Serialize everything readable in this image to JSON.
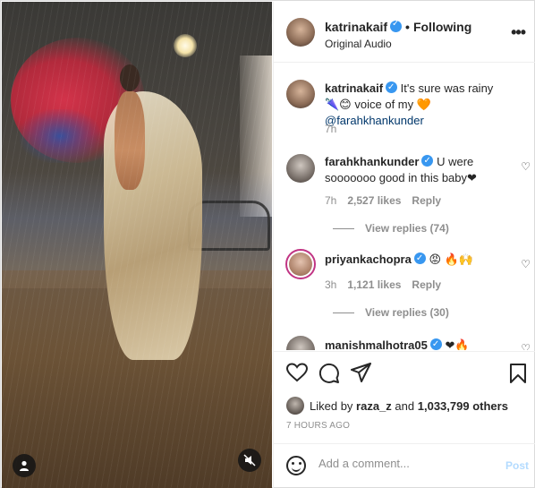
{
  "header": {
    "username": "katrinakaif",
    "separator": "•",
    "follow_status": "Following",
    "audio": "Original Audio",
    "more": "•••"
  },
  "caption": {
    "username": "katrinakaif",
    "text_part1": "It's sure was rainy 🌂😊",
    "text_part2": "voice of my 🧡",
    "mention": "@farahkhankunder",
    "time": "7h"
  },
  "comments": [
    {
      "username": "farahkhankunder",
      "text": "U were sooooooo good in this baby❤",
      "time": "7h",
      "likes": "2,527 likes",
      "reply": "Reply",
      "view_replies": "View replies (74)"
    },
    {
      "username": "priyankachopra",
      "text": "😡 🔥🙌",
      "time": "3h",
      "likes": "1,121 likes",
      "reply": "Reply",
      "view_replies": "View replies (30)"
    },
    {
      "username": "manishmalhotra05",
      "text": "❤🔥"
    }
  ],
  "likes": {
    "prefix": "Liked by",
    "user": "raza_z",
    "and": "and",
    "others": "1,033,799 others"
  },
  "time_ago": "7 HOURS AGO",
  "add_comment": {
    "placeholder": "Add a comment...",
    "post_label": "Post"
  },
  "icons": {
    "like": "heart-icon",
    "comment": "comment-icon",
    "share": "share-icon",
    "save": "bookmark-icon"
  },
  "colors": {
    "verified": "#3897f0",
    "mention": "#00376b",
    "post_disabled": "#b3dbff",
    "muted_text": "#8e8e8e"
  }
}
